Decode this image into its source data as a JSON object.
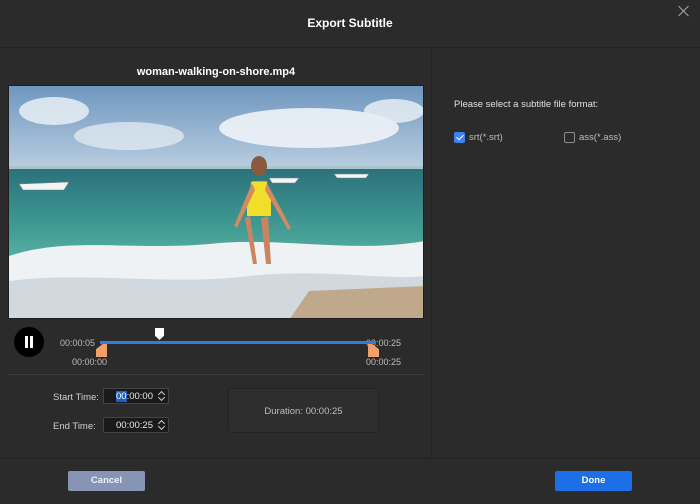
{
  "dialog": {
    "title": "Export Subtitle",
    "close_icon": "close-icon"
  },
  "preview": {
    "filename": "woman-walking-on-shore.mp4",
    "play_state_icon": "pause-icon",
    "current_time": "00:00:05",
    "range_start": "00:00:00",
    "range_end": "00:00:25",
    "end_time_label": "00:00:25",
    "playhead_fraction": 0.2
  },
  "trim": {
    "start_label": "Start Time:",
    "start_value_highlight": "00",
    "start_value_rest": ":00:00",
    "end_label": "End Time:",
    "end_value": "00:00:25",
    "duration_text": "Duration:  00:00:25"
  },
  "format": {
    "prompt": "Please select a subtitle file format:",
    "options": [
      {
        "label": "srt(*.srt)",
        "checked": true
      },
      {
        "label": "ass(*.ass)",
        "checked": false
      }
    ]
  },
  "footer": {
    "cancel_label": "Cancel",
    "done_label": "Done"
  },
  "colors": {
    "accent": "#1c6fe6",
    "track": "#2f7de1",
    "trim_handle": "#f2a06b",
    "cancel_button": "#8695b5"
  }
}
